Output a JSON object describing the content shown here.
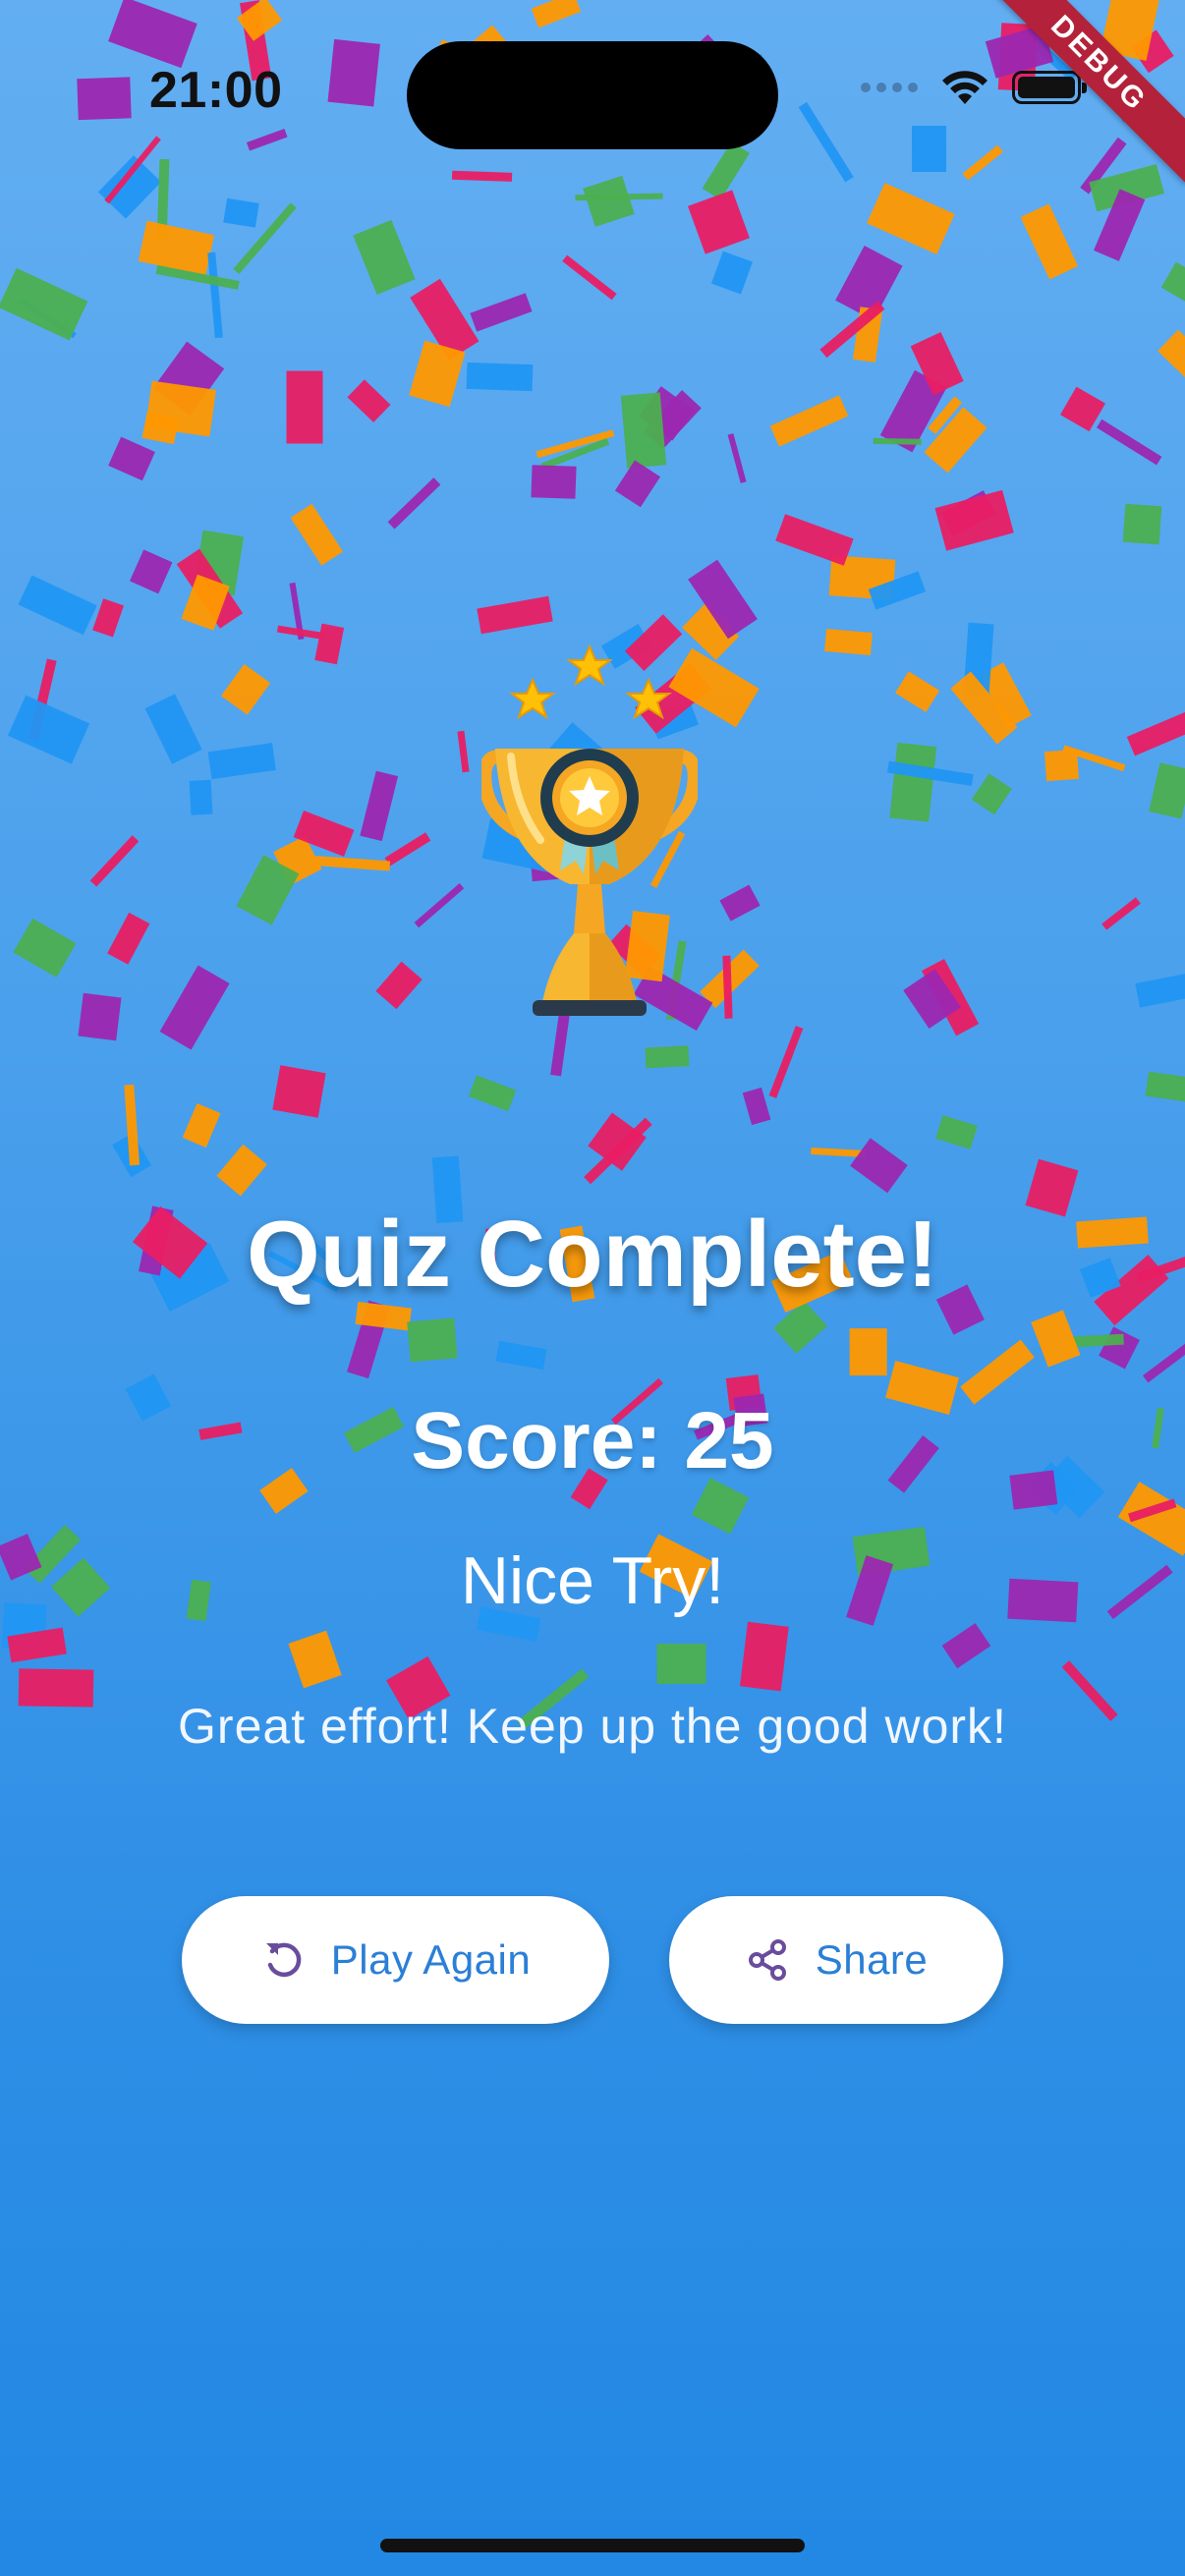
{
  "status_bar": {
    "time": "21:00"
  },
  "debug_banner": "DEBUG",
  "result": {
    "title": "Quiz Complete!",
    "score_text": "Score: 25",
    "verdict": "Nice Try!",
    "message": "Great effort! Keep up the good work!"
  },
  "actions": {
    "play_again_label": "Play Again",
    "share_label": "Share"
  },
  "colors": {
    "background_top": "#63aef2",
    "background_bottom": "#2288e3",
    "button_text": "#2b7fd6",
    "icon_purple": "#6a4c9c",
    "confetti": [
      "#e91e63",
      "#9c27b0",
      "#ff9800",
      "#4caf50",
      "#2196f3"
    ]
  },
  "icons": {
    "trophy": "trophy-icon",
    "play_again": "replay-icon",
    "share": "share-icon"
  }
}
